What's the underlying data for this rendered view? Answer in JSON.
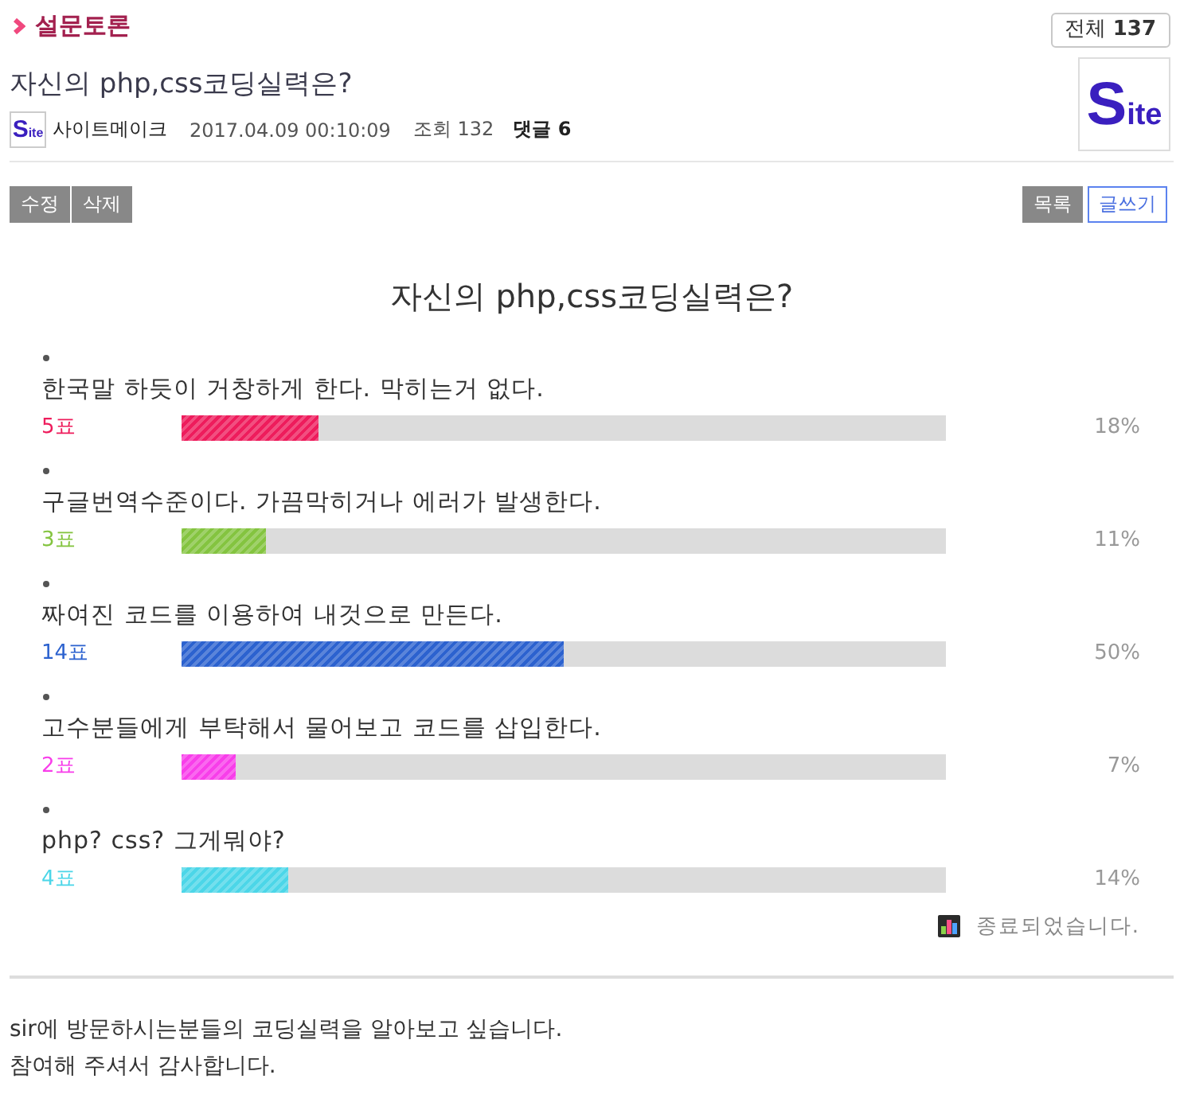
{
  "board": {
    "category": "설문토론",
    "total_badge": "전체 **137**"
  },
  "post": {
    "title": "자신의 php,css코딩실력은?",
    "author": {
      "avatar_text": "Site",
      "name": "사이트메이크"
    },
    "date": "2017.04.09 00:10:09",
    "views": "조회 132",
    "comments": "댓글 6",
    "thumbnail_text": "Site"
  },
  "left_buttons": [
    {
      "label": "수정",
      "kind": "gray"
    },
    {
      "label": "삭제",
      "kind": "gray"
    }
  ],
  "right_buttons": [
    {
      "label": "목록",
      "kind": "gray"
    },
    {
      "label": "글쓰기",
      "kind": "outline"
    }
  ],
  "poll": {
    "title": "자신의 php,css코딩실력은?",
    "options": [
      {
        "text": "한국말 하듯이 거창하게 한다. 막히는거 없다.",
        "votes": "5표",
        "percent": "18%",
        "level": 0.18,
        "color": "#ee1c5c"
      },
      {
        "text": "구글번역수준이다. 가끔막히거나 에러가 발생한다.",
        "votes": "3표",
        "percent": "11%",
        "level": 0.11,
        "color": "#84c440"
      },
      {
        "text": "짜여진 코드를 이용하여 내것으로 만든다.",
        "votes": "14표",
        "percent": "50%",
        "level": 0.5,
        "color": "#2c62cf"
      },
      {
        "text": "고수분들에게 부탁해서 물어보고 코드를 삽입한다.",
        "votes": "2표",
        "percent": "7%",
        "level": 0.07,
        "color": "#f83eea"
      },
      {
        "text": "php? css? 그게뭐야?",
        "votes": "4표",
        "percent": "14%",
        "level": 0.14,
        "color": "#4cd6e8"
      }
    ],
    "status": "종료되었습니다."
  },
  "body": [
    "sir에 방문하시는분들의 코딩실력을 알아보고 싶습니다.",
    "참여해 주셔서 감사합니다."
  ]
}
